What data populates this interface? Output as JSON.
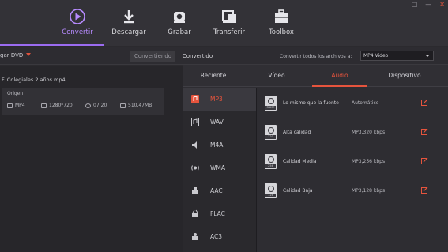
{
  "window": {
    "controls": [
      "□",
      "—",
      "✕"
    ]
  },
  "nav": {
    "items": [
      {
        "id": "convertir",
        "label": "Convertir",
        "icon": "convert-icon",
        "active": true
      },
      {
        "id": "descargar",
        "label": "Descargar",
        "icon": "download-icon",
        "active": false
      },
      {
        "id": "grabar",
        "label": "Grabar",
        "icon": "burn-disc-icon",
        "active": false
      },
      {
        "id": "transferir",
        "label": "Transferir",
        "icon": "transfer-icon",
        "active": false
      },
      {
        "id": "toolbox",
        "label": "Toolbox",
        "icon": "toolbox-icon",
        "active": false
      }
    ]
  },
  "subbar": {
    "grab_dvd": "gar DVD",
    "tab_converting": "Convertiendo",
    "tab_converted": "Convertido",
    "convert_all_label": "Convertir todos los archivos a:",
    "format_selected": "MP4 Video"
  },
  "file": {
    "name": "F. Colegiales 2 años.mp4",
    "origin_label": "Origen",
    "format": "MP4",
    "resolution": "1280*720",
    "duration": "07:20",
    "size": "510,47MB"
  },
  "panel": {
    "tabs": [
      {
        "id": "reciente",
        "label": "Reciente",
        "active": false
      },
      {
        "id": "video",
        "label": "Vídeo",
        "active": false
      },
      {
        "id": "audio",
        "label": "Audio",
        "active": true
      },
      {
        "id": "dispositivo",
        "label": "Dispositivo",
        "active": false
      }
    ],
    "formats": [
      {
        "label": "MP3",
        "icon": "mp3-icon",
        "active": true
      },
      {
        "label": "WAV",
        "icon": "wav-icon",
        "active": false
      },
      {
        "label": "M4A",
        "icon": "m4a-icon",
        "active": false
      },
      {
        "label": "WMA",
        "icon": "wma-icon",
        "active": false
      },
      {
        "label": "AAC",
        "icon": "aac-icon",
        "active": false
      },
      {
        "label": "FLAC",
        "icon": "flac-icon",
        "active": false
      },
      {
        "label": "AC3",
        "icon": "ac3-icon",
        "active": false
      }
    ],
    "qualities": [
      {
        "name": "Lo mismo que la fuente",
        "value": "Automático",
        "tag": "SAME"
      },
      {
        "name": "Alta calidad",
        "value": "MP3,320 kbps",
        "tag": "320"
      },
      {
        "name": "Calidad Media",
        "value": "MP3,256 kbps",
        "tag": "256"
      },
      {
        "name": "Calidad Baja",
        "value": "MP3,128 kbps",
        "tag": "128"
      }
    ]
  },
  "colors": {
    "accent": "#9b6cf0",
    "active_tab": "#e6543d",
    "background": "#2b2a2e"
  }
}
